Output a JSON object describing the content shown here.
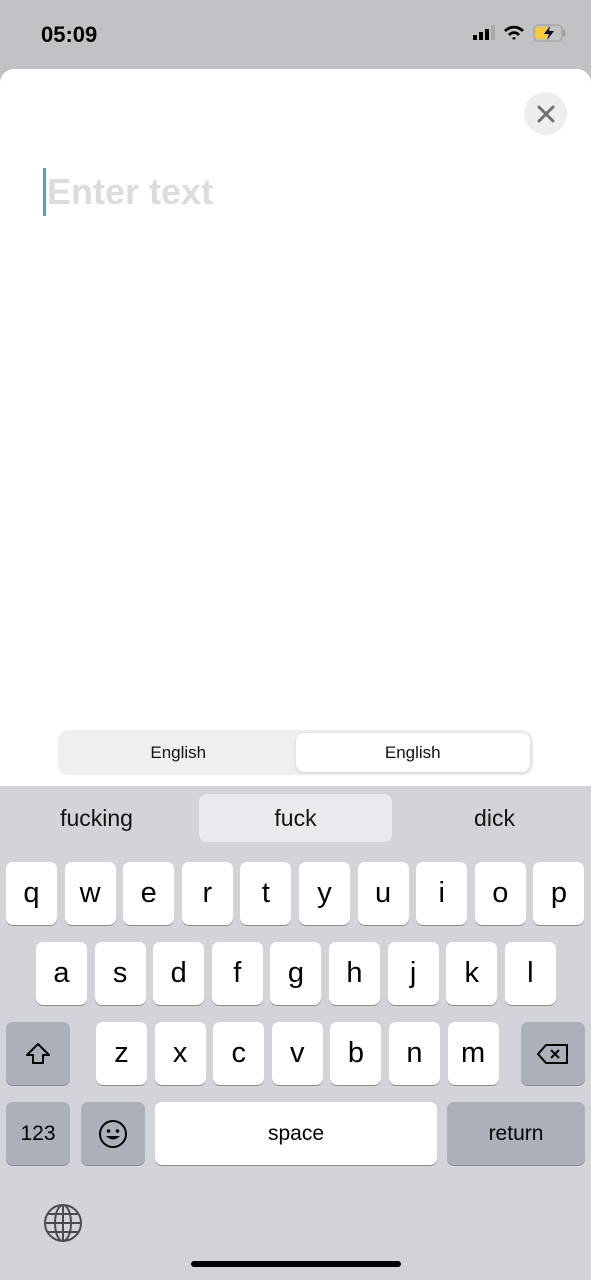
{
  "status": {
    "time": "05:09"
  },
  "editor": {
    "placeholder": "Enter text"
  },
  "languages": {
    "source": "English",
    "target": "English"
  },
  "suggestions": [
    "fucking",
    "fuck",
    "dick"
  ],
  "keyboard": {
    "row1": [
      "q",
      "w",
      "e",
      "r",
      "t",
      "y",
      "u",
      "i",
      "o",
      "p"
    ],
    "row2": [
      "a",
      "s",
      "d",
      "f",
      "g",
      "h",
      "j",
      "k",
      "l"
    ],
    "row3": [
      "z",
      "x",
      "c",
      "v",
      "b",
      "n",
      "m"
    ],
    "numbers": "123",
    "space": "space",
    "return": "return"
  }
}
